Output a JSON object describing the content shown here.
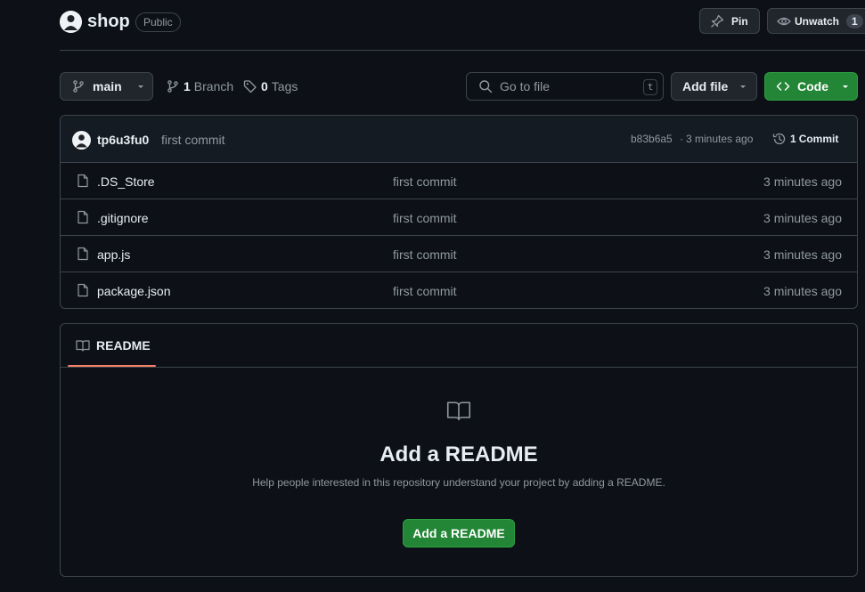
{
  "repo": {
    "name": "shop",
    "visibility": "Public"
  },
  "header_actions": {
    "pin_label": "Pin",
    "unwatch_label": "Unwatch",
    "watch_count": "1"
  },
  "toolbar": {
    "branch": "main",
    "branches_count": "1",
    "branches_label": "Branch",
    "tags_count": "0",
    "tags_label": "Tags",
    "go_to_file_placeholder": "Go to file",
    "go_to_file_shortcut": "t",
    "add_file_label": "Add file",
    "code_label": "Code",
    "code_color": "#238636"
  },
  "latest_commit": {
    "author": "tp6u3fu0",
    "message": "first commit",
    "hash": "b83b6a5",
    "separator": "·",
    "time": "3 minutes ago",
    "commits_count": "1",
    "commits_label": "Commit"
  },
  "files": [
    {
      "name": ".DS_Store",
      "message": "first commit",
      "time": "3 minutes ago"
    },
    {
      "name": ".gitignore",
      "message": "first commit",
      "time": "3 minutes ago"
    },
    {
      "name": "app.js",
      "message": "first commit",
      "time": "3 minutes ago"
    },
    {
      "name": "package.json",
      "message": "first commit",
      "time": "3 minutes ago"
    }
  ],
  "readme": {
    "tab_label": "README",
    "title": "Add a README",
    "description": "Help people interested in this repository understand your project by adding a README.",
    "button_label": "Add a README",
    "accent_color": "#f78166"
  },
  "icons": {
    "repo_avatar": "avatar-icon",
    "pin": "pin-icon",
    "eye": "eye-icon",
    "branch": "git-branch-icon",
    "tag": "tag-icon",
    "search": "search-icon",
    "code": "code-icon",
    "history": "history-icon",
    "file": "file-icon",
    "book": "book-icon"
  }
}
